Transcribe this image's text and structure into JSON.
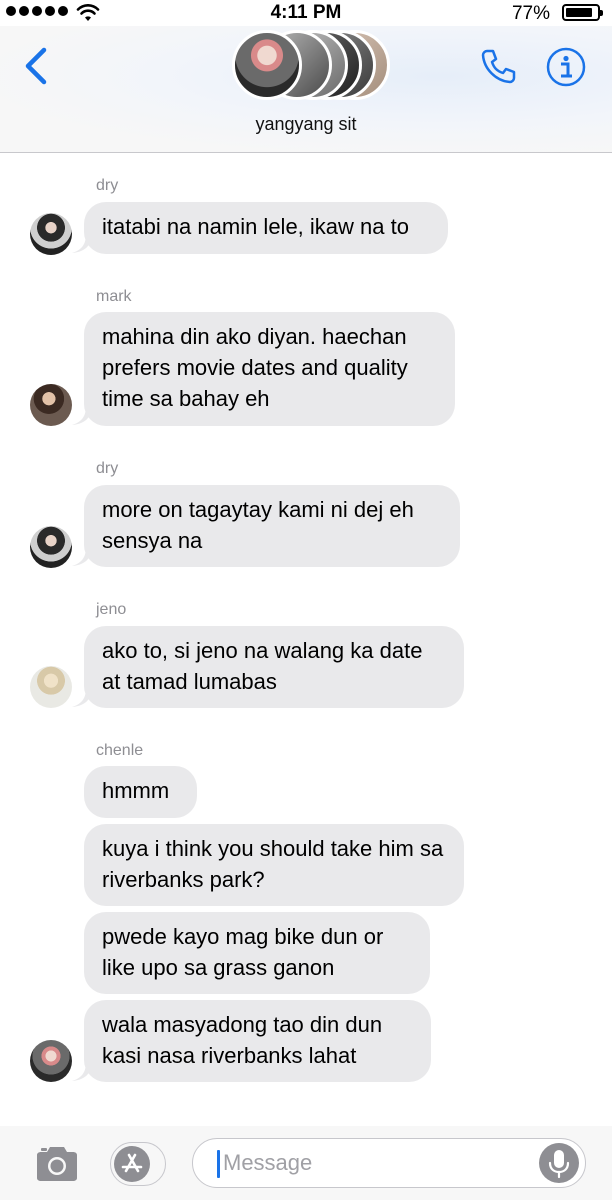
{
  "status_bar": {
    "time": "4:11 PM",
    "battery": "77%"
  },
  "header": {
    "group_name": "yangyang sit"
  },
  "messages": [
    {
      "sender": "dry",
      "text": "itatabi na namin lele, ikaw na to"
    },
    {
      "sender": "mark",
      "text": "mahina din ako diyan. haechan prefers movie dates and quality time sa bahay eh"
    },
    {
      "sender": "dry",
      "text": "more on tagaytay kami ni dej eh sensya na"
    },
    {
      "sender": "jeno",
      "text": "ako to, si jeno na walang ka date at tamad lumabas"
    },
    {
      "sender": "chenle",
      "texts": [
        "hmmm",
        "kuya i think you should take him sa riverbanks park?",
        "pwede kayo mag bike dun or like upo sa grass ganon",
        "wala masyadong tao din dun kasi nasa riverbanks lahat"
      ]
    }
  ],
  "composer": {
    "placeholder": "Message"
  },
  "colors": {
    "accent": "#1a73e8",
    "bubble": "#e9e9eb",
    "sender": "#8e8e93"
  }
}
